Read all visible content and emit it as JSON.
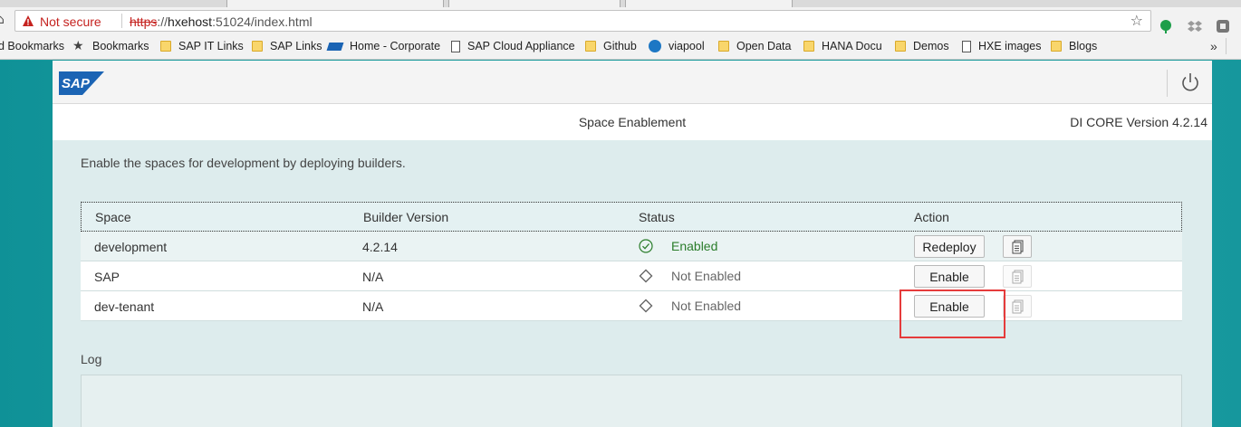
{
  "browser": {
    "security_label": "Not secure",
    "url_scheme": "https",
    "url_host": "hxehost",
    "url_rest": ":51024/index.html"
  },
  "bookmarks": [
    {
      "label": "d Bookmarks",
      "icon": "none"
    },
    {
      "label": "Bookmarks",
      "icon": "star"
    },
    {
      "label": "SAP IT Links",
      "icon": "folder"
    },
    {
      "label": "SAP Links",
      "icon": "folder"
    },
    {
      "label": "Home - Corporate",
      "icon": "sap"
    },
    {
      "label": "SAP Cloud Appliance",
      "icon": "page"
    },
    {
      "label": "Github",
      "icon": "folder"
    },
    {
      "label": "viapool",
      "icon": "viapool"
    },
    {
      "label": "Open Data",
      "icon": "folder"
    },
    {
      "label": "HANA Docu",
      "icon": "folder"
    },
    {
      "label": "Demos",
      "icon": "folder"
    },
    {
      "label": "HXE images",
      "icon": "page"
    },
    {
      "label": "Blogs",
      "icon": "folder"
    }
  ],
  "bookmarks_more": "»",
  "app": {
    "logo_text": "SAP",
    "subtitle": "Space Enablement",
    "version": "DI CORE Version 4.2.14",
    "intro": "Enable the spaces for development by deploying builders."
  },
  "table": {
    "headers": {
      "space": "Space",
      "builder": "Builder Version",
      "status": "Status",
      "action": "Action"
    },
    "rows": [
      {
        "space": "development",
        "builder": "4.2.14",
        "status": "Enabled",
        "action": "Redeploy"
      },
      {
        "space": "SAP",
        "builder": "N/A",
        "status": "Not Enabled",
        "action": "Enable"
      },
      {
        "space": "dev-tenant",
        "builder": "N/A",
        "status": "Not Enabled",
        "action": "Enable"
      }
    ]
  },
  "log": {
    "label": "Log"
  },
  "colors": {
    "enabled": "#2b7d2b",
    "highlight": "#e53b3b",
    "background": "#1a9a9c",
    "sap_blue": "#1b64b4"
  }
}
